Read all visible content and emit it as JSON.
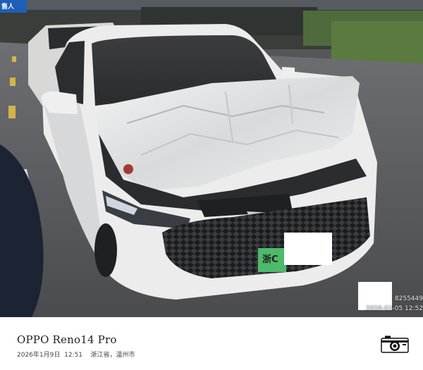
{
  "photo": {
    "sign_text": "售人",
    "plate_text": "浙C",
    "watermark_lines": [
      "8255449",
      "2026-01-05 12:52"
    ]
  },
  "footer": {
    "device_model": "OPPO Reno14 Pro",
    "date": "2026年1月9日",
    "time": "12:51",
    "location": "浙江省，温州市",
    "camera_icon": "camera-icon"
  }
}
